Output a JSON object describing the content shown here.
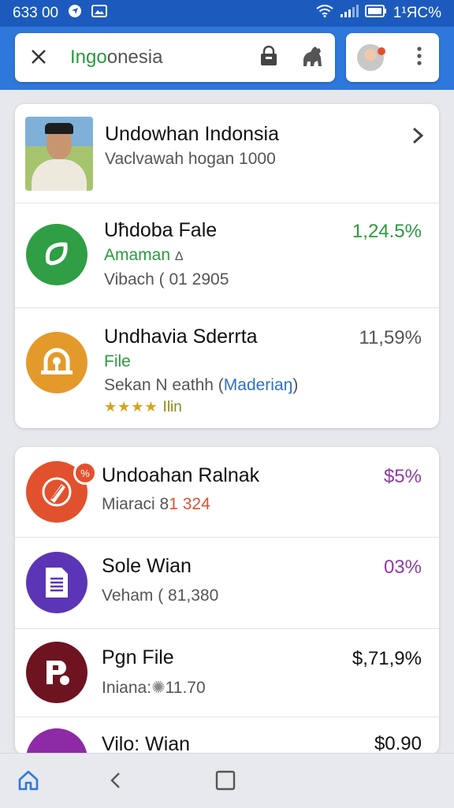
{
  "status_bar": {
    "time": "633 00",
    "battery": "1¹ЯC%"
  },
  "search": {
    "query_green": "Ingo",
    "query_rest": "onesia"
  },
  "featured": {
    "title": "Undowhan Indonsia",
    "subtitle": "Vaclvawah hogan 1000"
  },
  "list1": [
    {
      "title": "Uћdoba Fale",
      "tag": "Amaman",
      "tag_icon": "Δ",
      "detail": "Vibach ( 01 2905",
      "value": "1,24.5%",
      "value_color": "#2a9a3e",
      "icon": "leaf-icon",
      "icon_bg": "#2f9e44"
    },
    {
      "title": "Undhavia Sderrta",
      "tag": "File",
      "detail_prefix": "Sekan N eathh (",
      "detail_link": "Maderiaŋ",
      "detail_suffix": ")",
      "rating_text": "Ilin",
      "value": "11,59%",
      "value_color": "#555555",
      "icon": "cloud-upload-icon",
      "icon_bg": "#e49a2a"
    }
  ],
  "list2": [
    {
      "title": "Undoahan Ralnak",
      "detail_prefix": "Miaraci 8",
      "detail_highlight": "1 324",
      "value": "$5%",
      "value_color": "#8e3aa6",
      "icon": "pencil-icon",
      "icon_bg": "#e2512d",
      "badge": "%"
    },
    {
      "title": "Sole Wian",
      "detail": "Veham ( 81,380",
      "value": "03%",
      "value_color": "#8e3aa6",
      "icon": "document-icon",
      "icon_bg": "#5b35b5"
    },
    {
      "title": "Pgn File",
      "detail_prefix": "Iniana:",
      "detail_suffix": "11.70",
      "value": "$,71,9%",
      "value_color": "#111111",
      "icon": "r-logo-icon",
      "icon_bg": "#6e1420"
    },
    {
      "title": "Vilo: Wian",
      "value": "$0.90",
      "value_color": "#111111",
      "icon": "app-icon",
      "icon_bg": "#8e2aa6"
    }
  ]
}
